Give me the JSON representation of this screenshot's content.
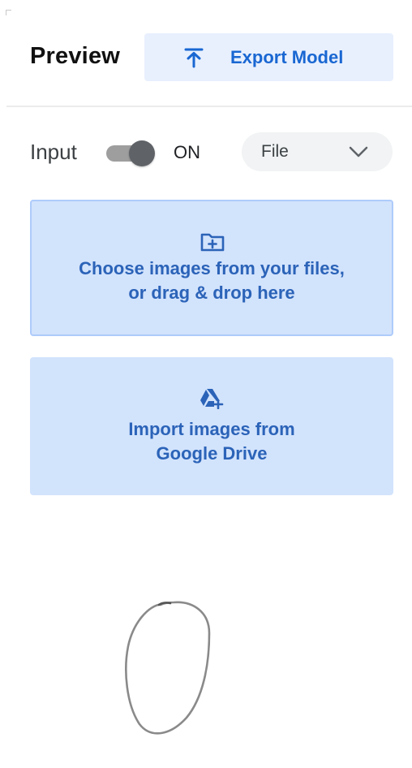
{
  "header": {
    "title": "Preview",
    "export_button": {
      "label": "Export Model",
      "icon": "upload-arrow-icon"
    }
  },
  "input": {
    "label": "Input",
    "toggle_on": true,
    "toggle_state_label": "ON",
    "source_select": {
      "value": "File",
      "icon": "chevron-down-icon"
    }
  },
  "upload_files": {
    "icon": "folder-add-icon",
    "line1": "Choose images from your files,",
    "line2": "or drag & drop here"
  },
  "import_drive": {
    "icon": "google-drive-icon",
    "line1": "Import images from",
    "line2": "Google Drive"
  },
  "colors": {
    "accent": "#1967d2",
    "card_background": "#d2e3fc",
    "export_background": "#e8f0fe",
    "toggle_track": "#9e9e9e",
    "toggle_knob": "#5f6368"
  }
}
